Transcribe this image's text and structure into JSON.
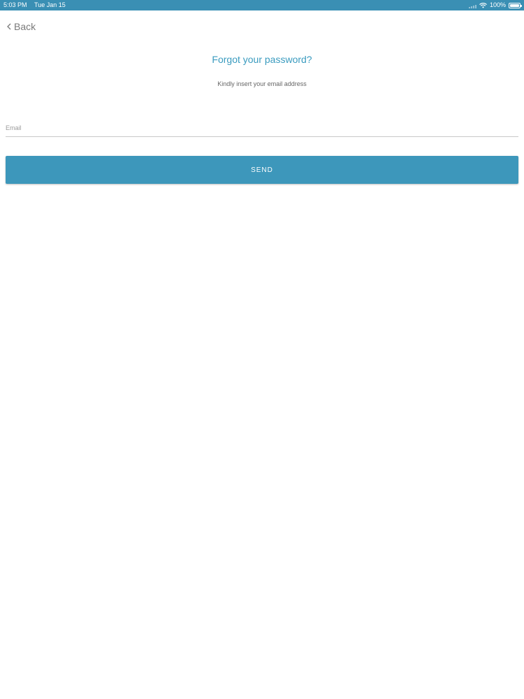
{
  "status_bar": {
    "time": "5:03 PM",
    "date": "Tue Jan 15",
    "battery_text": "100%",
    "battery_level": 1.0,
    "icons": [
      "signal-icon",
      "wifi-icon",
      "battery-icon"
    ],
    "background_color": "#3a8fb4"
  },
  "nav": {
    "back_label": "Back"
  },
  "header": {
    "title": "Forgot your password?",
    "subtitle": "Kindly insert your email address"
  },
  "form": {
    "email_placeholder": "Email",
    "email_value": "",
    "send_label": "SEND"
  },
  "colors": {
    "accent": "#3d97bb",
    "title": "#3a9bbf"
  }
}
